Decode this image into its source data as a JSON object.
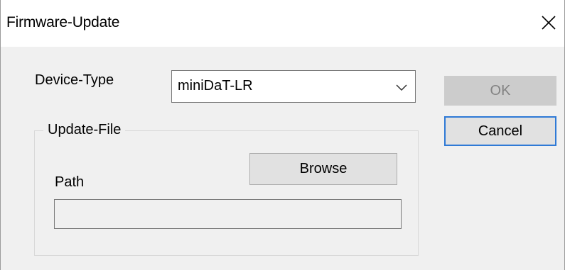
{
  "window": {
    "title": "Firmware-Update",
    "close_icon": "close-icon"
  },
  "device_type": {
    "label": "Device-Type",
    "selected_value": "miniDaT-LR",
    "arrow_icon": "chevron-down-icon"
  },
  "buttons": {
    "ok_label": "OK",
    "cancel_label": "Cancel"
  },
  "update_file": {
    "group_label": "Update-File",
    "path_label": "Path",
    "browse_label": "Browse",
    "path_value": ""
  },
  "colors": {
    "focus_border": "#2f7ad6",
    "disabled_button": "#cccccc",
    "window_background": "#f0f0f0"
  }
}
